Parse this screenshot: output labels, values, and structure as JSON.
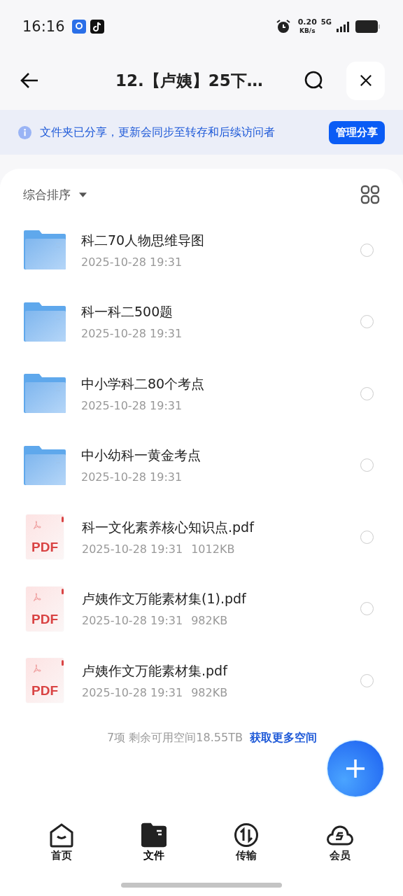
{
  "status_bar": {
    "time": "16:16",
    "speed": "0.20",
    "speed_unit": "KB/s",
    "network": "5G"
  },
  "header": {
    "title": "12.【卢姨】25下…"
  },
  "banner": {
    "text": "文件夹已分享，更新会同步至转存和后续访问者",
    "button": "管理分享"
  },
  "sort": {
    "label": "综合排序"
  },
  "files": [
    {
      "kind": "folder",
      "name": "科二70人物思维导图",
      "date": "2025-10-28 19:31",
      "selected": false
    },
    {
      "kind": "folder",
      "name": "科一科二500题",
      "date": "2025-10-28 19:31",
      "selected": false
    },
    {
      "kind": "folder",
      "name": "中小学科二80个考点",
      "date": "2025-10-28 19:31",
      "selected": false
    },
    {
      "kind": "folder",
      "name": "中小幼科一黄金考点",
      "date": "2025-10-28 19:31",
      "selected": false
    },
    {
      "kind": "pdf",
      "badge": "PDF",
      "name": "科一文化素养核心知识点.pdf",
      "date": "2025-10-28 19:31",
      "size": "1012KB",
      "selected": false
    },
    {
      "kind": "pdf",
      "badge": "PDF",
      "name": "卢姨作文万能素材集(1).pdf",
      "date": "2025-10-28 19:31",
      "size": "982KB",
      "selected": false
    },
    {
      "kind": "pdf",
      "badge": "PDF",
      "name": "卢姨作文万能素材集.pdf",
      "date": "2025-10-28 19:31",
      "size": "982KB",
      "selected": false
    }
  ],
  "footer": {
    "summary": "7项 剩余可用空间18.55TB",
    "link": "获取更多空间"
  },
  "tabs": [
    {
      "kind": "home",
      "label": "首页",
      "selected": false
    },
    {
      "kind": "files",
      "label": "文件",
      "selected": true
    },
    {
      "kind": "transfer",
      "label": "传输",
      "selected": false
    },
    {
      "kind": "member",
      "label": "会员",
      "selected": false
    }
  ]
}
